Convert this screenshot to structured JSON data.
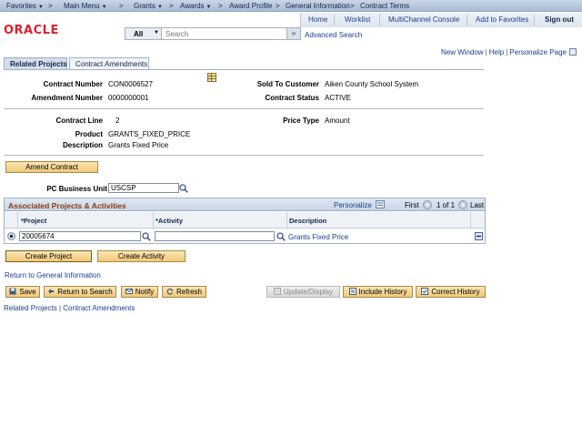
{
  "menu": {
    "favorites": "Favorites",
    "main_menu": "Main Menu",
    "crumb1": "Grants",
    "crumb2": "Awards",
    "crumb3": "Award Profile",
    "crumb4": "General Information",
    "crumb5": "Contract Terms",
    "sep": ">"
  },
  "header": {
    "logo": "ORACLE",
    "links": [
      "Home",
      "Worklist",
      "MultiChannel Console",
      "Add to Favorites",
      "Sign out"
    ],
    "search_scope": "All",
    "search_placeholder": "Search",
    "search_go": "»",
    "advanced_search": "Advanced Search"
  },
  "pagelinks": {
    "new_window": "New Window",
    "help": "Help",
    "personalize": "Personalize Page",
    "pipe": "|"
  },
  "tabs": [
    "Related Projects",
    "Contract Amendments"
  ],
  "contract": {
    "contract_number_label": "Contract Number",
    "contract_number": "CON0006527",
    "amendment_number_label": "Amendment Number",
    "amendment_number": "0000000001",
    "sold_to_label": "Sold To Customer",
    "sold_to": "Aiken County School System",
    "status_label": "Contract Status",
    "status": "ACTIVE",
    "line_label": "Contract Line",
    "line": "2",
    "price_type_label": "Price Type",
    "price_type": "Amount",
    "product_label": "Product",
    "product": "GRANTS_FIXED_PRICE",
    "description_label": "Description",
    "description": "Grants Fixed Price"
  },
  "amend_button": "Amend Contract",
  "pc_bu_label": "PC Business Unit",
  "pc_bu": "USCSP",
  "grid": {
    "title": "Associated Projects & Activities",
    "personalize": "Personalize",
    "first": "First",
    "range": "1 of 1",
    "last": "Last",
    "col_project": "*Project",
    "col_activity": "*Activity",
    "col_description": "Description",
    "row_project": "20005674",
    "row_activity": "",
    "row_description": "Grants Fixed Price"
  },
  "create_project": "Create Project",
  "create_activity": "Create Activity",
  "return_link": "Return to General Information",
  "toolbar": {
    "save": "Save",
    "return_to_search": "Return to Search",
    "notify": "Notify",
    "refresh": "Refresh",
    "update_display": "Update/Display",
    "include_history": "Include History",
    "correct_history": "Correct History"
  },
  "bottom_links": [
    "Related Projects",
    "Contract Amendments"
  ],
  "bottom_pipe": "|"
}
